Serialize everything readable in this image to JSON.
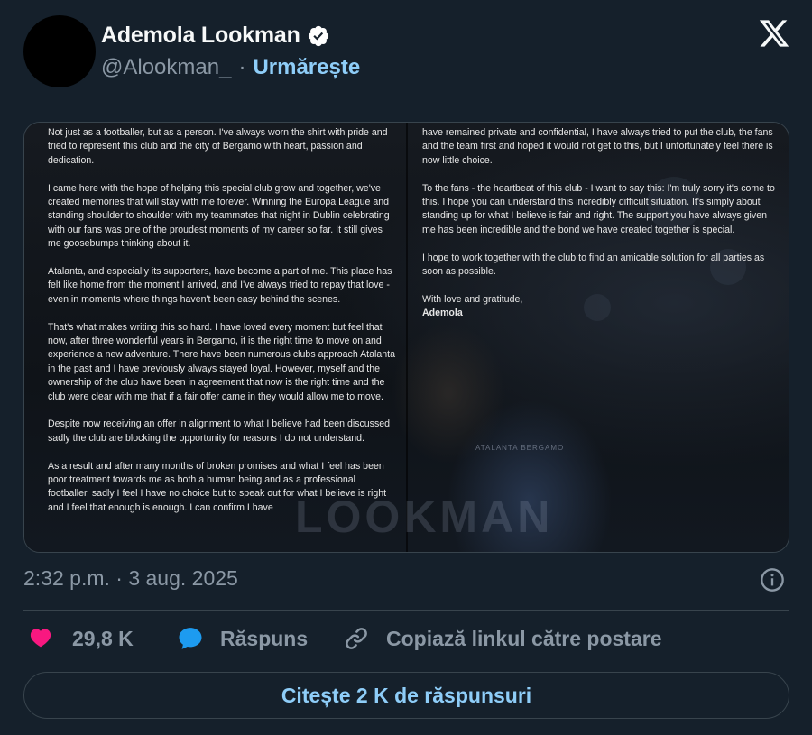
{
  "user": {
    "display_name": "Ademola Lookman",
    "handle": "@Alookman_",
    "separator": "·",
    "follow_label": "Urmărește"
  },
  "colors": {
    "background": "#15202b",
    "text_primary": "#f7f9f9",
    "text_secondary": "#8b98a5",
    "accent": "#8ecdf8",
    "verified": "#ffffff",
    "like": "#f91880",
    "reply": "#1d9bf0",
    "border": "#38444d"
  },
  "icons": {
    "verified": "verified-badge-icon",
    "platform": "x-logo-icon",
    "info": "info-icon",
    "like": "heart-icon",
    "reply": "speech-bubble-icon",
    "copy_link": "link-icon"
  },
  "media": {
    "watermark": "LOOKMAN",
    "jersey_text": "ATALANTA BERGAMO",
    "left_column": [
      "Not just as a footballer, but as a person. I've always worn the shirt with pride and tried to represent this club and the city of Bergamo with heart, passion and dedication.",
      "I came here with the hope of helping this special club grow and together, we've created memories that will stay with me forever. Winning the Europa League and standing shoulder to shoulder with my teammates that night in Dublin celebrating with our fans was one of the proudest moments of my career so far. It still gives me goosebumps thinking about it.",
      "Atalanta, and especially its supporters, have become a part of me. This place has felt like home from the moment I arrived, and I've always tried to repay that love - even in moments where things haven't been easy behind the scenes.",
      "That's what makes writing this so hard. I have loved every moment but feel that now, after three wonderful years in Bergamo, it is the right time to move on and experience a new adventure. There have been numerous clubs approach Atalanta in the past and I have previously always stayed loyal. However, myself and the ownership of the club have been in agreement that now is the right time and the club were clear with me that if a fair offer came in they would allow me to move.",
      "Despite now receiving an offer in alignment to what I believe had been discussed sadly the club are blocking the opportunity for reasons I do not understand.",
      "As a result and after many months of broken promises and what I feel has  been poor treatment towards me as both a human being and as a professional footballer, sadly I feel I have no choice but to speak out for what I believe is right and I feel that enough is enough. I can confirm I have"
    ],
    "right_column": [
      "have remained private and confidential, I have always tried to put the club, the fans and the team first and hoped it would not get to this, but I unfortunately feel there is now little choice.",
      "To the fans - the heartbeat of this club - I want to say this: I'm truly sorry it's come to this. I hope you can understand this incredibly difficult situation. It's simply about standing up for what I believe is fair and right. The support you have always given me has been incredible and the bond we have created together is special.",
      "I hope to work together with the club to find an amicable solution for all parties as soon as possible."
    ],
    "signoff": "With love and gratitude,",
    "signature": "Ademola"
  },
  "timestamp": "2:32 p.m. · 3 aug. 2025",
  "actions": {
    "likes": "29,8 K",
    "reply_label": "Răspuns",
    "copy_label": "Copiază linkul către postare"
  },
  "read_replies_label": "Citește 2 K de răspunsuri"
}
